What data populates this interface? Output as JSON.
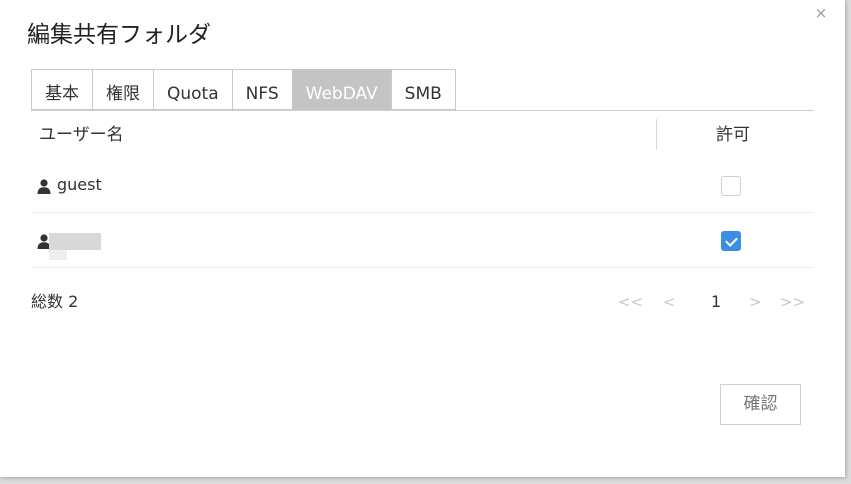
{
  "dialog": {
    "title": "編集共有フォルダ",
    "close_glyph": "×"
  },
  "tabs": [
    {
      "label": "基本",
      "active": false
    },
    {
      "label": "権限",
      "active": false
    },
    {
      "label": "Quota",
      "active": false
    },
    {
      "label": "NFS",
      "active": false
    },
    {
      "label": "WebDAV",
      "active": true
    },
    {
      "label": "SMB",
      "active": false
    }
  ],
  "table": {
    "col_user": "ユーザー名",
    "col_permission": "許可",
    "rows": [
      {
        "name": "guest",
        "allowed": false
      },
      {
        "name": "",
        "allowed": true
      }
    ]
  },
  "footer": {
    "total_label": "総数 2"
  },
  "pagination": {
    "first": "<<",
    "prev": "<",
    "current": "1",
    "next": ">",
    "last": ">>"
  },
  "confirm_label": "確認",
  "colors": {
    "accent": "#3b8de6",
    "active_tab": "#c4c4c4"
  },
  "icons": {
    "user": "user-icon",
    "close": "close-icon"
  }
}
